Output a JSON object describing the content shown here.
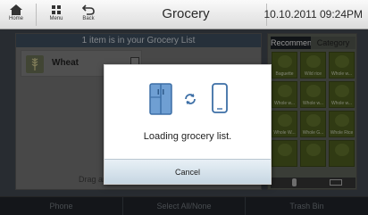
{
  "header": {
    "home_label": "Home",
    "menu_label": "Menu",
    "back_label": "Back",
    "title": "Grocery",
    "datetime": "10.10.2011 09:24PM"
  },
  "list_panel": {
    "header_text": "1 item is in your Grocery List",
    "items": [
      {
        "label": "Wheat"
      }
    ],
    "drag_hint": "Drag an"
  },
  "side_panel": {
    "tabs": [
      {
        "label": "Recommend",
        "active": true
      },
      {
        "label": "Category",
        "active": false
      }
    ],
    "grid_items": [
      {
        "label": "Baguette"
      },
      {
        "label": "Wild rice"
      },
      {
        "label": "Whole w..."
      },
      {
        "label": "Whole w..."
      },
      {
        "label": "Whole w..."
      },
      {
        "label": "Whole w..."
      },
      {
        "label": "Whole W..."
      },
      {
        "label": "Whole G..."
      },
      {
        "label": "Whole Rice"
      },
      {
        "label": ""
      },
      {
        "label": ""
      },
      {
        "label": ""
      }
    ]
  },
  "bottom_bar": {
    "phone_label": "Phone",
    "select_label": "Select All/None",
    "trash_label": "Trash Bin"
  },
  "dialog": {
    "message": "Loading grocery list.",
    "cancel_label": "Cancel"
  },
  "colors": {
    "accent_blue": "#4a7fb5",
    "cancel_bg": "#c6d6e2",
    "grid_green": "#4a5a1e"
  }
}
